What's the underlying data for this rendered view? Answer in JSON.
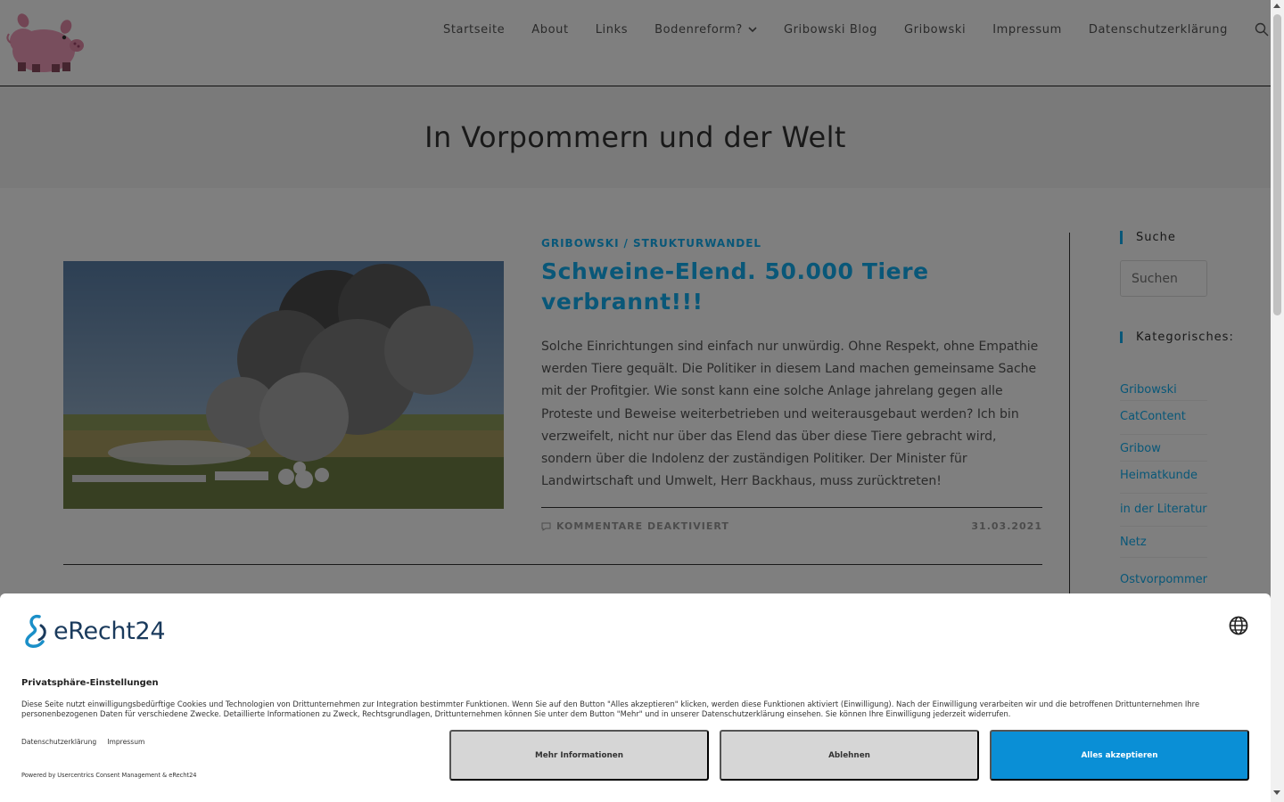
{
  "nav": {
    "items": [
      {
        "label": "Startseite"
      },
      {
        "label": "About"
      },
      {
        "label": "Links"
      },
      {
        "label": "Bodenreform?",
        "has_dropdown": true
      },
      {
        "label": "Gribowski Blog"
      },
      {
        "label": "Gribowski"
      },
      {
        "label": "Impressum"
      },
      {
        "label": "Datenschutzerklärung"
      }
    ]
  },
  "page": {
    "title": "In Vorpommern und der Welt"
  },
  "post": {
    "categories": [
      "GRIBOWSKI",
      "STRUKTURWANDEL"
    ],
    "category_separator": "/",
    "title": "Schweine-Elend. 50.000 Tiere verbrannt!!!",
    "excerpt": "Solche Einrichtungen sind einfach nur unwürdig. Ohne Respekt, ohne Empathie werden Tiere gequält. Die Politiker in diesem Land machen gemeinsame Sache mit der Profitgier. Wie sonst kann eine solche Anlage jahrelang gegen alle Proteste und Beweise weiterbetrieben und weiterausgebaut werden? Ich bin verzweifelt, nicht nur über das Elend das über diese Tiere gebracht wird, sondern über die Indolenz der zuständigen Politiker. Der Minister für Landwirtschaft und Umwelt, Herr Backhaus, muss zurücktreten!",
    "comments": "KOMMENTARE DEAKTIVIERT",
    "date": "31.03.2021"
  },
  "sidebar": {
    "search_title": "Suche",
    "search_placeholder": "Suchen",
    "categories_title": "Kategorisches:",
    "categories": [
      {
        "label": "Gribowski"
      },
      {
        "label": "CatContent"
      },
      {
        "label": "Gribow"
      },
      {
        "label": "Heimatkunde"
      },
      {
        "label": "in der Literatur"
      },
      {
        "label": "Netz"
      },
      {
        "label": "Ostvorpommer"
      }
    ]
  },
  "consent": {
    "brand": "eRecht24",
    "title": "Privatsphäre-Einstellungen",
    "text": "Diese Seite nutzt einwilligungsbedürftige Cookies und Technologien von Drittunternehmen zur Integration bestimmter Funktionen. Wenn Sie auf den Button \"Alles akzeptieren\" klicken, werden diese Funktionen aktiviert (Einwilligung). Nach der Einwilligung verarbeiten wir und die betroffenen Drittunternehmen Ihre personenbezogenen Daten für verschiedene Zwecke. Detaillierte Informationen zu Zweck, Rechtsgrundlagen, Drittunternehmen können Sie unter dem Button \"Mehr\" und in unserer Datenschutzerklärung einsehen. Sie können Ihre Einwilligung jederzeit widerrufen.",
    "link_privacy": "Datenschutzerklärung",
    "link_imprint": "Impressum",
    "powered": "Powered by Usercentrics Consent Management & eRecht24",
    "btn_more": "Mehr Informationen",
    "btn_decline": "Ablehnen",
    "btn_accept": "Alles akzeptieren"
  },
  "colors": {
    "accent": "#13aff0",
    "accept_button": "#0a8fd6",
    "brand_dark": "#1a3a5c"
  }
}
